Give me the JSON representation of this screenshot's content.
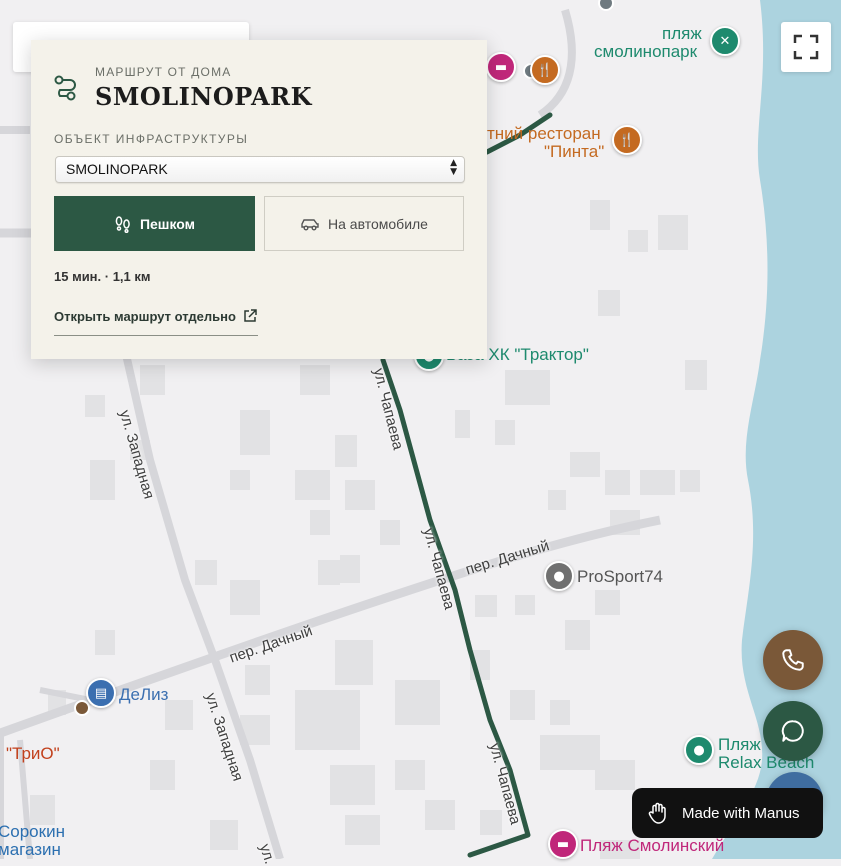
{
  "panel": {
    "overline": "МАРШРУТ ОТ ДОМА",
    "title": "SMOLINOPARK",
    "field_label": "ОБЪЕКТ ИНФРАСТРУКТУРЫ",
    "select_value": "SMOLINOPARK",
    "walk_label": "Пешком",
    "car_label": "На автомобиле",
    "route_info": "15 мин. · 1,1 км",
    "open_route_link": "Открыть маршрут отдельно"
  },
  "map": {
    "pois": [
      {
        "name": "пляж",
        "color": "#1e8a6e"
      },
      {
        "name": "смолинопарк",
        "color": "#1e8a6e"
      },
      {
        "name": "тний ресторан",
        "color": "#c46a21"
      },
      {
        "name": "\"Пинта\"",
        "color": "#c46a21"
      },
      {
        "name": "База ХК \"Трактор\"",
        "color": "#1e8a6e"
      },
      {
        "name": "ProSport74",
        "color": "#555555"
      },
      {
        "name": "ДеЛиз",
        "color": "#3b6fb0"
      },
      {
        "name": "\"ТриО\"",
        "color": "#c2411d"
      },
      {
        "name": "Сорокин",
        "color": "#2b6fb0"
      },
      {
        "name": "магазин",
        "color": "#2b6fb0"
      },
      {
        "name": "Пляж",
        "color": "#1e8a6e"
      },
      {
        "name": "Relax Beach",
        "color": "#1e8a6e"
      },
      {
        "name": "Пляж Смолинский",
        "color": "#c0277a"
      }
    ],
    "streets": [
      "ул. Западная",
      "ул. Западная",
      "пер. Дачный",
      "пер. Дачный",
      "ул. Чапаева",
      "ул. Чапаева",
      "ул."
    ],
    "colors": {
      "water": "#acd3df",
      "route": "#2c5844",
      "land": "#f1f0f2",
      "building": "#e2e2e4"
    }
  },
  "controls": {
    "fullscreen_icon": "fullscreen-icon",
    "phone_icon": "phone-icon",
    "chat_icon": "chat-icon"
  },
  "badge": {
    "label": "Made with Manus"
  }
}
